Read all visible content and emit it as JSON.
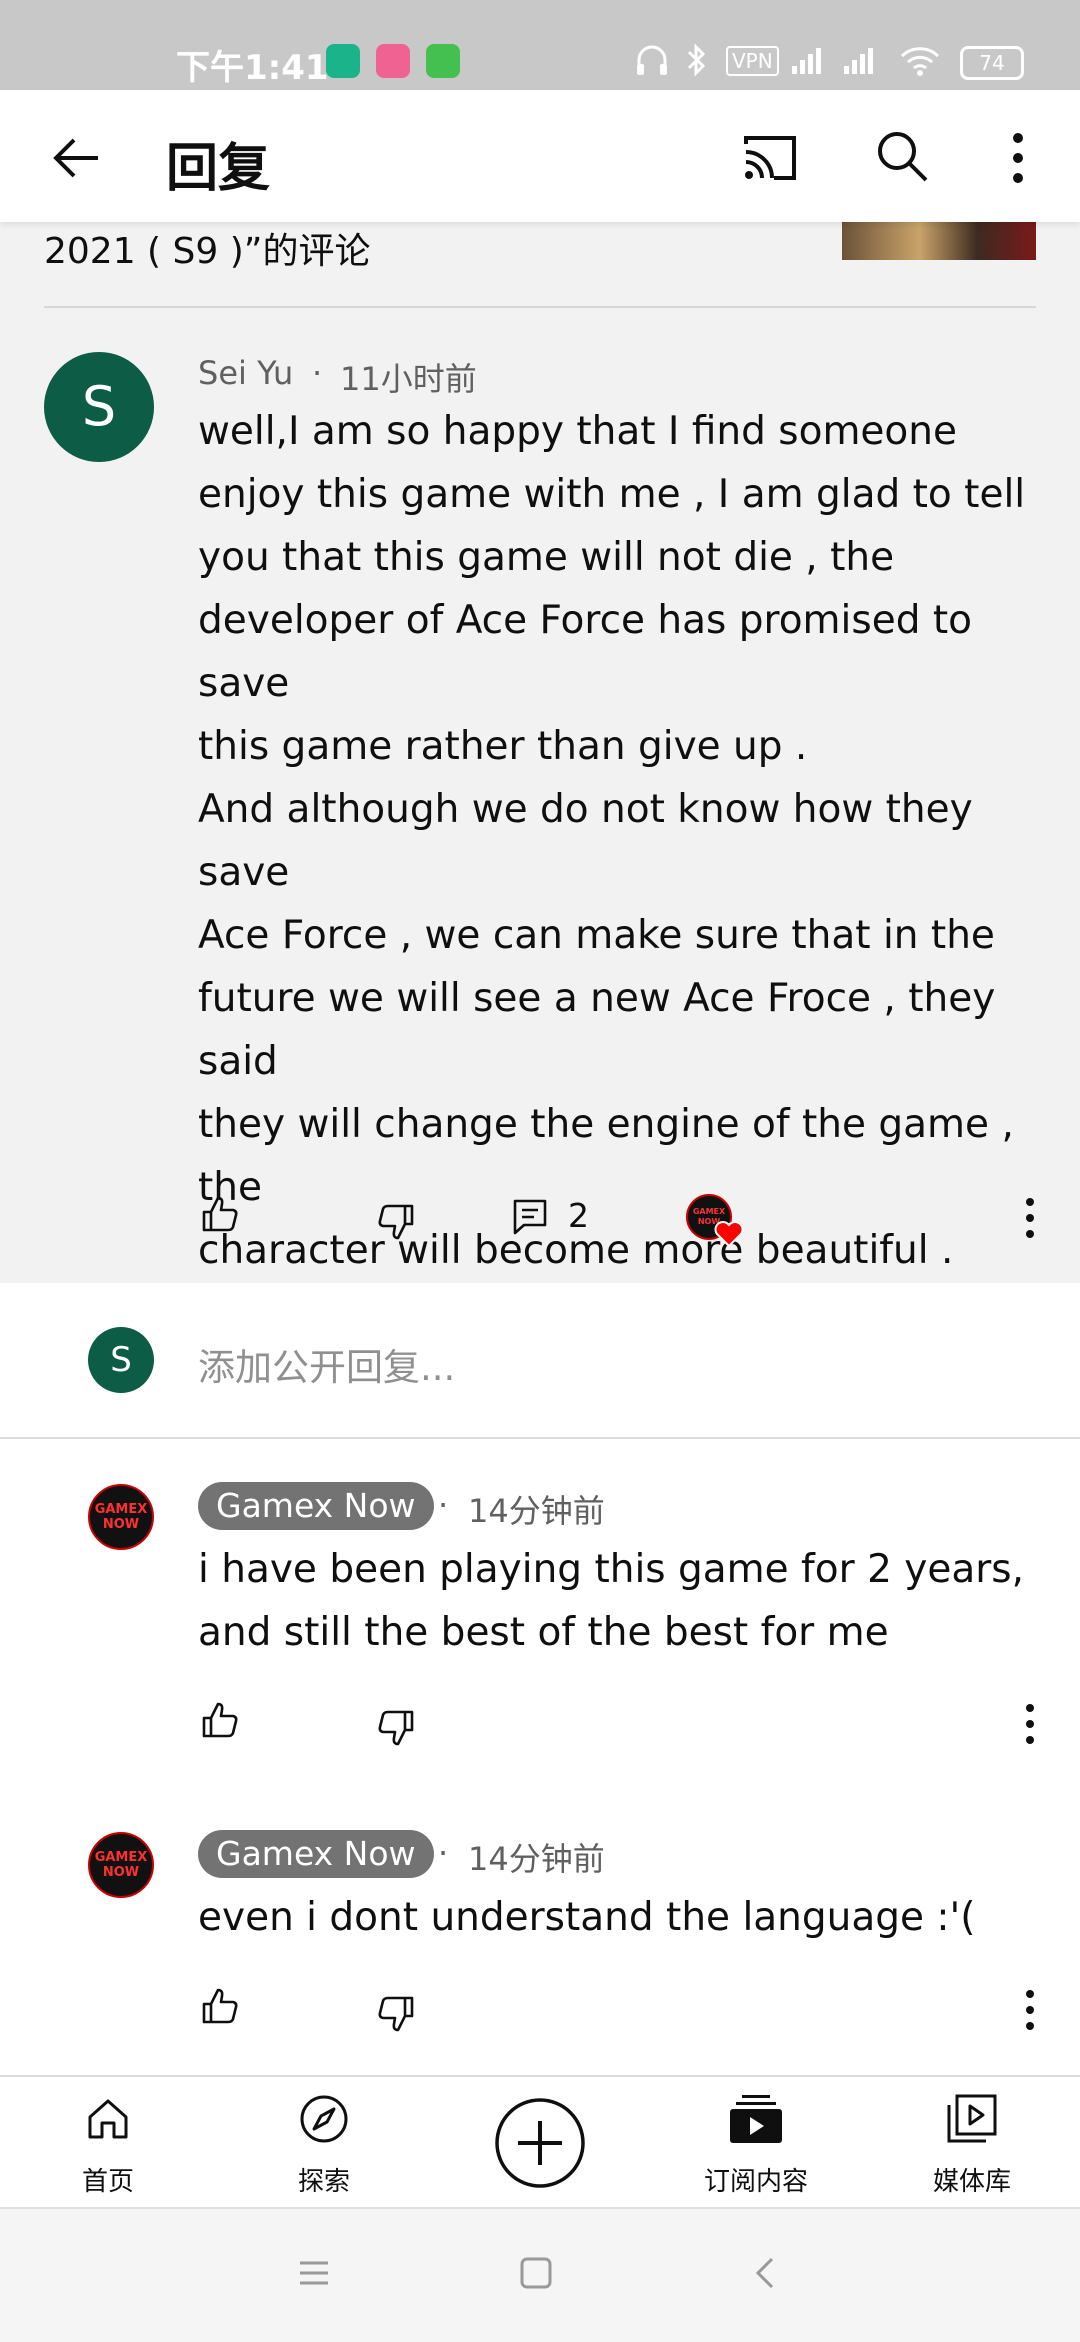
{
  "status_bar": {
    "time": "下午1:41",
    "vpn": "VPN",
    "battery": "74"
  },
  "app_bar": {
    "title": "回复",
    "back_icon": "arrow-left-icon",
    "cast_icon": "cast-icon",
    "search_icon": "search-icon",
    "more_icon": "more-vert-icon"
  },
  "context": {
    "text": "2021 ( S9 )”的评论"
  },
  "parent_comment": {
    "avatar_letter": "S",
    "author": "Sei Yu",
    "separator": "·",
    "time": "11小时前",
    "body": "well,I am so happy that I find someone\nenjoy this game with me , I am glad to tell\nyou that this game will not die , the\ndeveloper of Ace Force has promised to save\nthis game rather than give up .\nAnd although we do not know how they save\nAce Force , we can make sure that in the\nfuture we will see a new Ace Froce , they said\nthey will change the engine of the game ,\nthe\ncharacter will become more beautiful .\nSo , thank you for like this game.",
    "reply_count": "2",
    "creator_avatar_text": "GAMEX NOW"
  },
  "reply_input": {
    "avatar_letter": "S",
    "placeholder": "添加公开回复..."
  },
  "replies": [
    {
      "author": "Gamex Now",
      "separator": "·",
      "time": "14分钟前",
      "avatar_text": "GAMEX NOW",
      "body": "i have been playing this game for 2 years,\nand still the best of the best for me"
    },
    {
      "author": "Gamex Now",
      "separator": "·",
      "time": "14分钟前",
      "avatar_text": "GAMEX NOW",
      "body": "even i dont understand the language :'("
    }
  ],
  "bottom_nav": {
    "items": [
      {
        "label": "首页",
        "icon": "home-icon"
      },
      {
        "label": "探索",
        "icon": "explore-icon"
      },
      {
        "label": "",
        "icon": "create-icon"
      },
      {
        "label": "订阅内容",
        "icon": "subscriptions-icon"
      },
      {
        "label": "媒体库",
        "icon": "library-icon"
      }
    ]
  }
}
